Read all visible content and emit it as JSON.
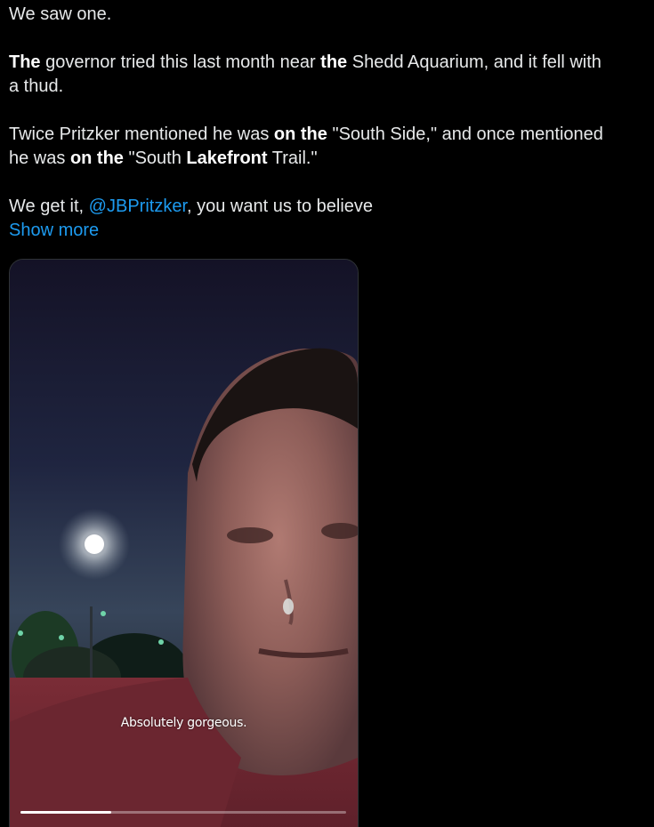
{
  "tweet": {
    "lines": {
      "p1": "We saw one.",
      "p2_a": "The",
      "p2_b": " governor tried this last month near ",
      "p2_c": "the",
      "p2_d": " Shedd Aquarium, and it fell with",
      "p2_e": "a thud.",
      "p3_a": "Twice Pritzker mentioned he was ",
      "p3_b": "on the",
      "p3_c": " \"South Side,\" and once mentioned",
      "p3_d": "he was ",
      "p3_e": "on the",
      "p3_f": " \"South ",
      "p3_g": "Lakefront",
      "p3_h": " Trail.\"",
      "p4_a": "We get it, ",
      "p4_mention": "@JBPritzker",
      "p4_b": ", you want us to believe"
    },
    "show_more_label": "Show more"
  },
  "video": {
    "caption": "Absolutely gorgeous.",
    "progress": 0.28
  },
  "colors": {
    "link": "#1d9bf0",
    "text": "#e7e9ea",
    "background": "#000000"
  }
}
